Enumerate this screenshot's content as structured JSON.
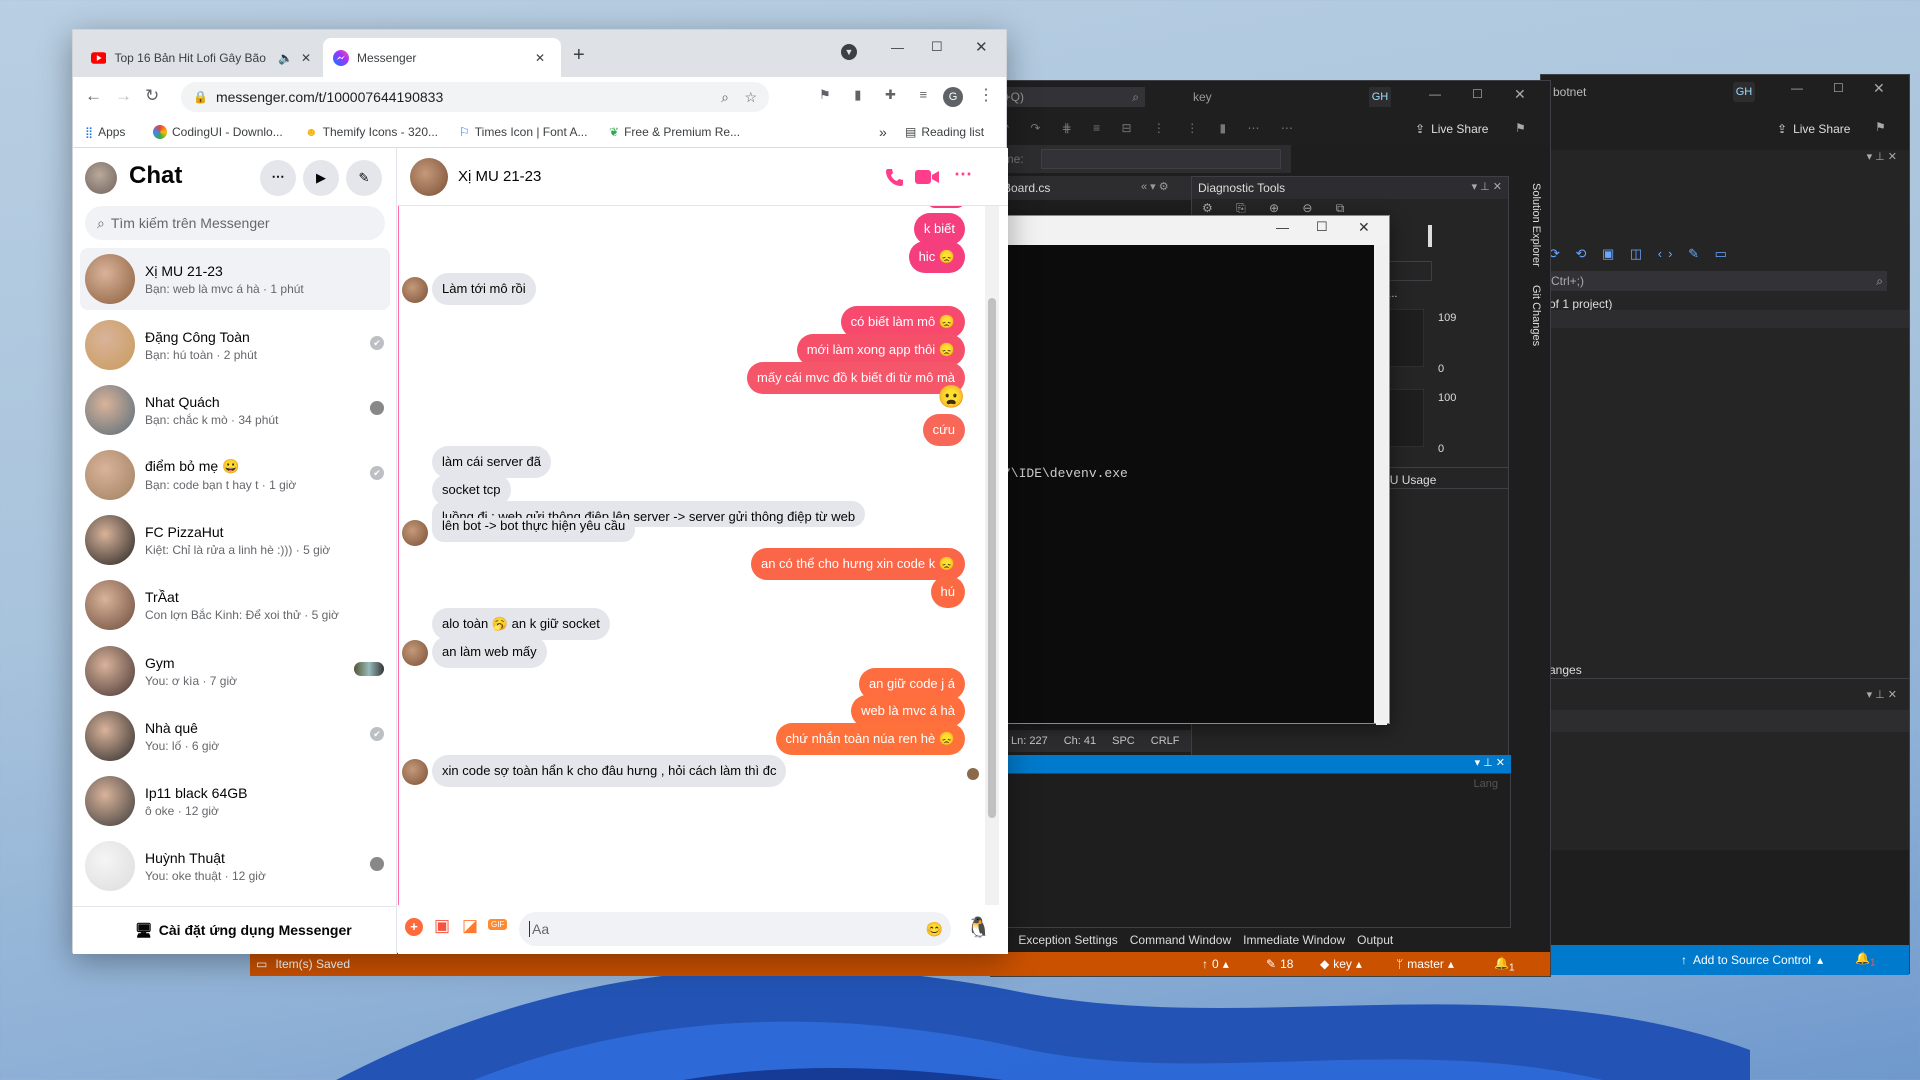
{
  "browser": {
    "tabs": [
      {
        "title": "Top 16 Bản Hit Lofi Gây Bão",
        "active": false
      },
      {
        "title": "Messenger",
        "active": true
      }
    ],
    "url": "messenger.com/t/100007644190833",
    "profile_initial": "G",
    "bookmarks": [
      "Apps",
      "CodingUI - Downlo...",
      "Themify Icons - 320...",
      "Times Icon | Font A...",
      "Free & Premium Re..."
    ],
    "reading_list": "Reading list",
    "overflow": "»"
  },
  "messenger": {
    "title": "Chat",
    "search_placeholder": "Tìm kiếm trên Messenger",
    "conversations": [
      {
        "name": "Xị MU 21-23",
        "preview": "Bạn: web là mvc á hà · 1 phút",
        "selected": true
      },
      {
        "name": "Đặng Công Toàn",
        "preview": "Bạn: hú toàn · 2 phút"
      },
      {
        "name": "Nhat Quách",
        "preview": "Bạn: chắc k mò · 34 phút"
      },
      {
        "name": "điểm bỏ mẹ 😀",
        "preview": "Bạn: code bạn t hay t · 1 giờ"
      },
      {
        "name": "FC PizzaHut",
        "preview": "Kiệt: Chỉ là rửa a linh hè :))) · 5 giờ"
      },
      {
        "name": "TrẦat",
        "preview": "Con lợn Bắc Kinh: Để xoi thử · 5 giờ"
      },
      {
        "name": "Gym",
        "preview": "You: ơ kìa · 7 giờ"
      },
      {
        "name": "Nhà quê",
        "preview": "You: lố · 6 giờ"
      },
      {
        "name": "Ip11 black 64GB",
        "preview": "ô oke · 12 giờ"
      },
      {
        "name": "Huỳnh Thuật",
        "preview": "You: oke thuật · 12 giờ"
      }
    ],
    "install_label": "Cài đặt ứng dụng Messenger",
    "chat_title": "Xị MU 21-23",
    "composer_placeholder": "Aa",
    "messages": [
      {
        "dir": "out",
        "text": "k biết"
      },
      {
        "dir": "out",
        "text": "hic 😞"
      },
      {
        "dir": "in",
        "text": "Làm tới mô rồi"
      },
      {
        "dir": "out",
        "text": "có biết làm mô 😞"
      },
      {
        "dir": "out",
        "text": "mới làm xong app thôi 😞"
      },
      {
        "dir": "out",
        "text": "mấy cái mvc đồ k biết đi từ mô mà"
      },
      {
        "dir": "out",
        "text": "😦"
      },
      {
        "dir": "out",
        "text": "cứu"
      },
      {
        "dir": "in",
        "text": "làm cái server đã"
      },
      {
        "dir": "in",
        "text": "socket tcp"
      },
      {
        "dir": "in",
        "text": "luồng đi : web gửi thông điệp lên server -> server gửi thông điệp từ web"
      },
      {
        "dir": "in",
        "text": "lên bot -> bot thực hiện yêu cầu"
      },
      {
        "dir": "out",
        "text": "an có thể cho hưng xin code k 😞"
      },
      {
        "dir": "out",
        "text": "hú"
      },
      {
        "dir": "in",
        "text": "alo toàn 🥱 an k giữ socket"
      },
      {
        "dir": "in",
        "text": "an làm web mấy"
      },
      {
        "dir": "out",
        "text": "an giữ code j á"
      },
      {
        "dir": "out",
        "text": "web là mvc á hà"
      },
      {
        "dir": "out",
        "text": "chứ nhắn toàn núa ren hè 😞"
      },
      {
        "dir": "in",
        "text": "xin code sợ toàn hẩn k cho đâu hưng , hỏi cách làm thì đc"
      }
    ],
    "colors": {
      "accent": "#ff3d8a",
      "bubble_pink": "#f43e7e",
      "bubble_orange": "#ff6a3d",
      "incoming": "#e4e6eb"
    }
  },
  "vs_main": {
    "search_hint": "l+Q)",
    "solution_name": "key",
    "user_initials": "GH",
    "live_share": "Live Share",
    "doc_tab": "yBoard.cs",
    "name_label": "ame:",
    "diag_title": "Diagnostic Tools",
    "diag_legend": [
      "S",
      "Pr..."
    ],
    "graph_max_1": "109",
    "graph_min_1": "0",
    "graph_max_2": "100",
    "graph_min_2": "0",
    "diag_tabs": [
      "sage",
      "CPU Usage"
    ],
    "status_fields": [
      "Ln: 227",
      "Ch: 41",
      "SPC",
      "CRLF"
    ],
    "output_lang": "Lang",
    "bottom_tabs": [
      "ts",
      "Exception Settings",
      "Command Window",
      "Immediate Window",
      "Output"
    ],
    "side_tabs": [
      "Solution Explorer",
      "Git Changes"
    ],
    "statusbar": {
      "saved": "Item(s) Saved",
      "up": "0",
      "edits": "18",
      "repo": "key",
      "branch": "master",
      "notif": "1"
    },
    "status_color": "#ca5100"
  },
  "vs_second": {
    "title": "botnet",
    "user_initials": "GH",
    "live_share": "Live Share",
    "search_hint": "Ctrl+;)",
    "project_text": "of 1 project)",
    "changes_text": "anges",
    "add_source": "Add to Source Control",
    "notif": "1",
    "status_color": "#007acc"
  },
  "console": {
    "path_text": "7\\IDE\\devenv.exe"
  }
}
